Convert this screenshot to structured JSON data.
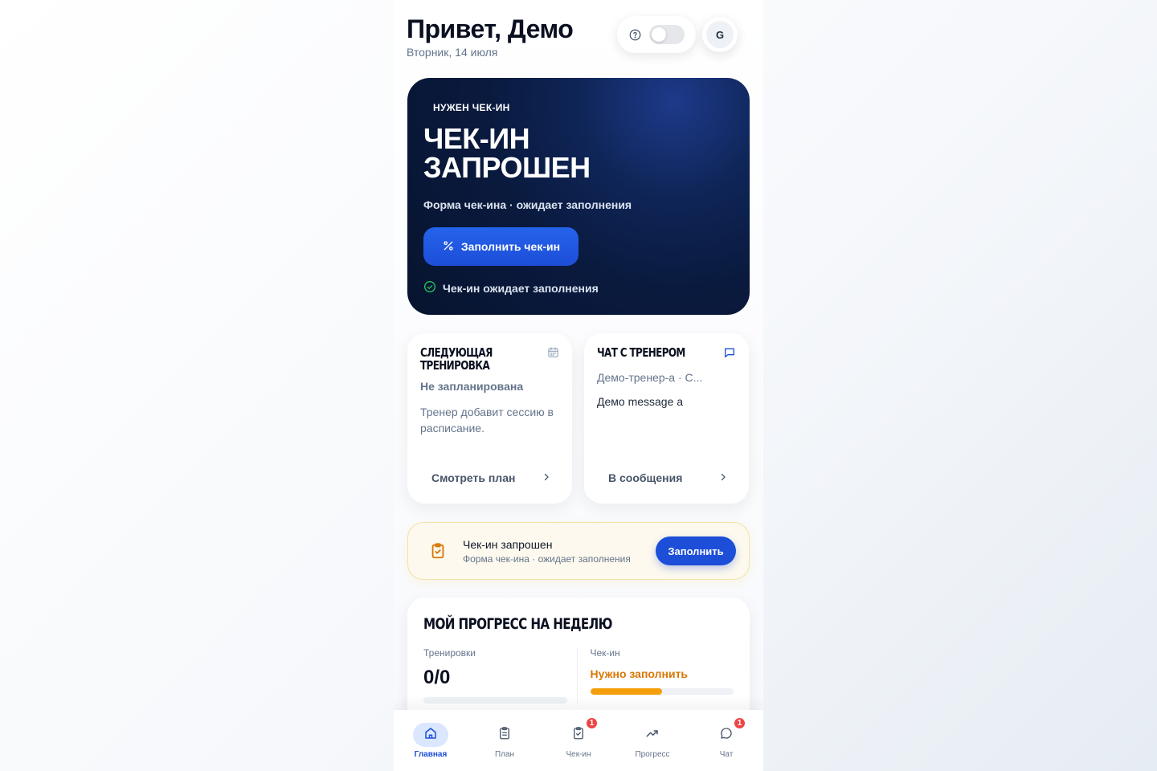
{
  "header": {
    "greeting": "Привет, Демо",
    "date": "Вторник, 14 июля",
    "avatar_initial": "G",
    "theme_toggle_on": false
  },
  "hero": {
    "badge": "НУЖЕН ЧЕК-ИН",
    "title_line1": "ЧЕК-ИН",
    "title_line2": "ЗАПРОШЕН",
    "subtitle": "Форма чек-ина · ожидает заполнения",
    "button_label": "Заполнить чек-ин",
    "status": "Чек-ин ожидает заполнения"
  },
  "next_workout": {
    "title_line1": "СЛЕДУЮЩАЯ",
    "title_line2": "ТРЕНИРОВКА",
    "status": "Не запланирована",
    "description": "Тренер добавит сессию в расписание.",
    "link": "Смотреть план"
  },
  "coach_chat": {
    "title": "ЧАТ С ТРЕНЕРОМ",
    "coach": "Демо-тренер-а · С...",
    "message": "Демо message a",
    "link": "В сообщения"
  },
  "notice": {
    "title": "Чек-ин запрошен",
    "subtitle": "Форма чек-ина · ожидает заполнения",
    "button_label": "Заполнить"
  },
  "progress": {
    "title": "МОЙ ПРОГРЕСС НА НЕДЕЛЮ",
    "workouts_label": "Тренировки",
    "workouts_value": "0/0",
    "workouts_fraction": 0,
    "checkin_label": "Чек-ин",
    "checkin_value": "Нужно заполнить",
    "checkin_fraction": 0.5
  },
  "nav": {
    "items": [
      {
        "label": "Главная",
        "icon": "home-icon",
        "active": true,
        "badge": ""
      },
      {
        "label": "План",
        "icon": "clipboard-icon",
        "active": false,
        "badge": ""
      },
      {
        "label": "Чек-ин",
        "icon": "clipboard-check-icon",
        "active": false,
        "badge": "1"
      },
      {
        "label": "Прогресс",
        "icon": "trending-up-icon",
        "active": false,
        "badge": ""
      },
      {
        "label": "Чат",
        "icon": "chat-bubble-icon",
        "active": false,
        "badge": "1"
      }
    ]
  },
  "colors": {
    "accent": "#1d4ed8",
    "hero_bg": "#0a1a3e",
    "warning": "#d97706",
    "badge": "#ef4444",
    "success": "#22c55e"
  }
}
